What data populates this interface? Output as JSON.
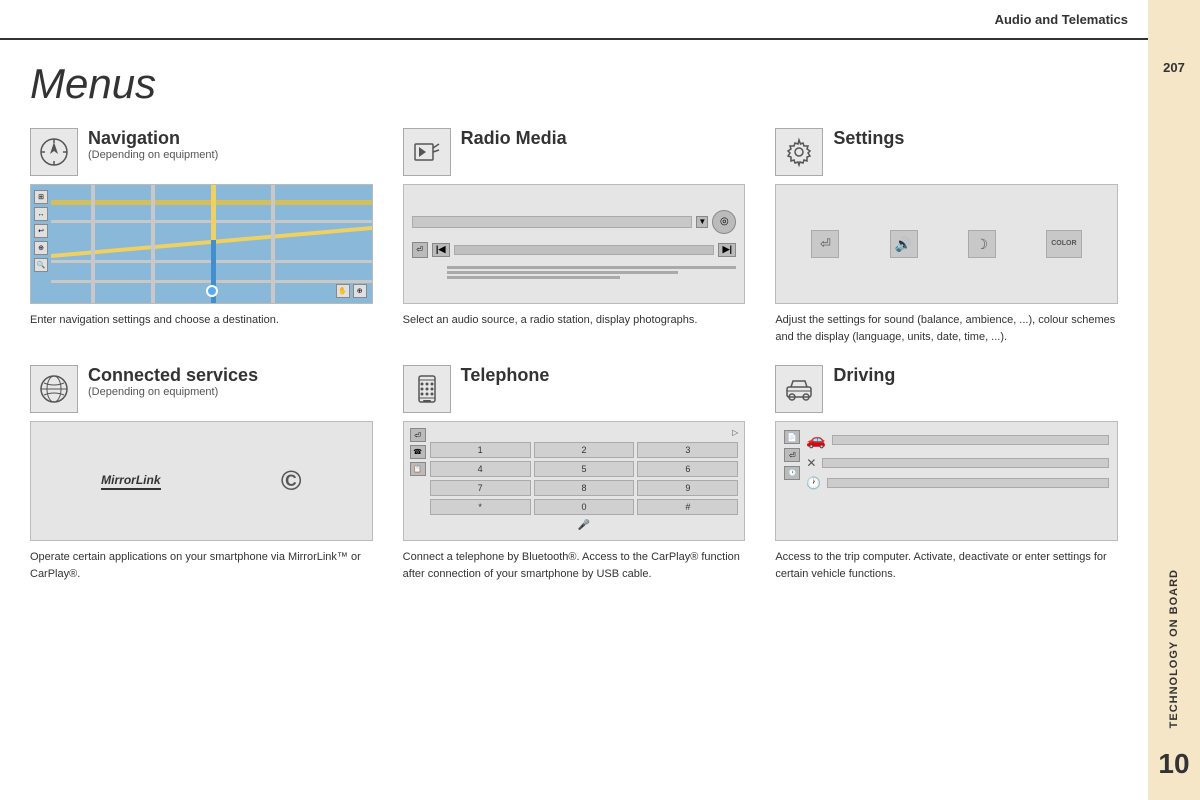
{
  "header": {
    "title": "Audio and Telematics"
  },
  "sidebar": {
    "page_top": "207",
    "technology_label": "TECHNOLOGY on BOARD",
    "page_bottom": "10"
  },
  "page": {
    "heading": "Menus"
  },
  "menus": [
    {
      "id": "navigation",
      "title": "Navigation",
      "subtitle": "(Depending on equipment)",
      "description": "Enter navigation settings and choose a destination."
    },
    {
      "id": "radio-media",
      "title": "Radio Media",
      "subtitle": "",
      "description": "Select an audio source, a radio station, display photographs."
    },
    {
      "id": "settings",
      "title": "Settings",
      "subtitle": "",
      "description": "Adjust the settings for sound (balance, ambience, ...), colour schemes and the display (language, units, date, time, ...)."
    },
    {
      "id": "connected-services",
      "title": "Connected services",
      "subtitle": "(Depending on equipment)",
      "description": "Operate certain applications on your smartphone via MirrorLink™ or CarPlay®."
    },
    {
      "id": "telephone",
      "title": "Telephone",
      "subtitle": "",
      "description": "Connect a telephone by Bluetooth®.\nAccess to the CarPlay® function after connection of your smartphone by USB cable."
    },
    {
      "id": "driving",
      "title": "Driving",
      "subtitle": "",
      "description": "Access to the trip computer.\nActivate, deactivate or enter settings for certain vehicle functions."
    }
  ],
  "keypad": {
    "keys": [
      "1",
      "2",
      "3",
      "4",
      "5",
      "6",
      "7",
      "8",
      "9",
      "*",
      "0",
      "#"
    ]
  }
}
